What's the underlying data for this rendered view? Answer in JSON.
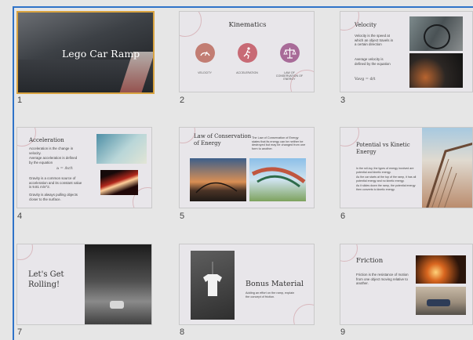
{
  "slides": [
    {
      "number": "1",
      "title": "Lego Car Ramp"
    },
    {
      "number": "2",
      "title": "Kinematics",
      "items": [
        {
          "label": "VELOCITY",
          "color": "#c27d73"
        },
        {
          "label": "ACCELERATION",
          "color": "#c86a75"
        },
        {
          "label": "LAW OF CONSERVATION OF ENERGY",
          "color": "#a86b98"
        }
      ]
    },
    {
      "number": "3",
      "title": "Velocity",
      "bullets": [
        "Velocity is the speed at which an object travels in a certain direction",
        "Average velocity is defined by the equation"
      ],
      "equation": "Vavg = d/t"
    },
    {
      "number": "4",
      "title": "Acceleration",
      "bullets": [
        "Acceleration is the change in velocity.",
        "Average acceleration is defined by the equation",
        "Gravity is a common source of acceleration and its constant value is 9.81 m/s^2.",
        "Gravity is always pulling objects closer to the surface."
      ],
      "equation": "a = Δv/t"
    },
    {
      "number": "5",
      "title": "Law of Conservation of Energy",
      "body": "The Law of Conservation of Energy states that its energy can be neither be destroyed but may be changed from one form to another."
    },
    {
      "number": "6",
      "title": "Potential vs Kinetic Energy",
      "bullets": [
        "In the roll-toy, the types of energy involved are potential and kinetic energy.",
        "As the car starts at the top of the ramp, it has all potential energy and no kinetic energy.",
        "As it slides down the ramp, the potential energy then converts to kinetic energy."
      ]
    },
    {
      "number": "7",
      "title": "Let's Get Rolling!"
    },
    {
      "number": "8",
      "title": "Bonus Material",
      "body": "Adding an effort on the ramp, explain the concept of friction."
    },
    {
      "number": "9",
      "title": "Friction",
      "body": "Friction is the resistance of motion from one object moving relative to another."
    }
  ]
}
